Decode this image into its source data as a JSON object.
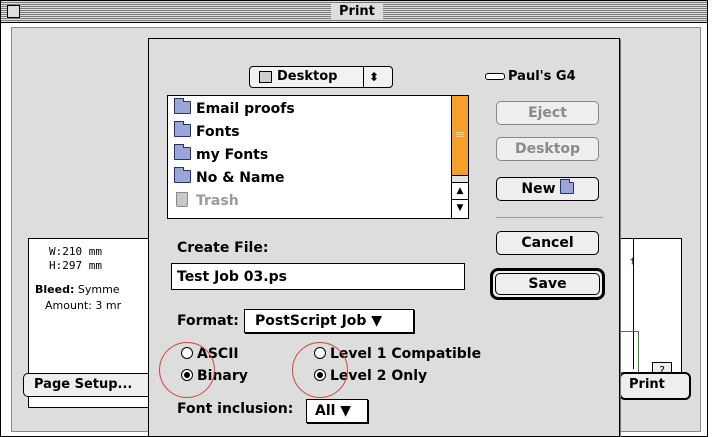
{
  "print_window": {
    "title": "Print",
    "page_info": {
      "width": "W:210  mm",
      "height": "H:297  mm",
      "bleed_label": "Bleed:",
      "bleed_value": "Symme",
      "amount": "Amount: 3  mr"
    },
    "help_label": "?",
    "page_setup_label": "Page Setup...",
    "print_label": "Print"
  },
  "save_dialog": {
    "folder_popup": {
      "label": "Desktop",
      "arrows": "⬍"
    },
    "disk_name": "Paul's G4",
    "files": [
      {
        "name": "Email proofs",
        "enabled": true
      },
      {
        "name": "Fonts",
        "enabled": true
      },
      {
        "name": "my Fonts",
        "enabled": true
      },
      {
        "name": "No & Name",
        "enabled": true
      },
      {
        "name": "Trash",
        "enabled": false
      }
    ],
    "buttons": {
      "eject": "Eject",
      "desktop": "Desktop",
      "new": "New",
      "cancel": "Cancel",
      "save": "Save"
    },
    "create_file_label": "Create File:",
    "filename_value": "Test Job 03.ps",
    "format_label": "Format:",
    "format_value": "PostScript Job ▼",
    "encoding": {
      "ascii": "ASCII",
      "binary": "Binary",
      "selected": "binary"
    },
    "level": {
      "level1": "Level 1 Compatible",
      "level2": "Level 2 Only",
      "selected": "level2"
    },
    "font_inclusion_label": "Font inclusion:",
    "font_inclusion_value": "All ▼"
  },
  "colors": {
    "scroll_thumb": "#f5a02a",
    "annotation_circle": "#d94040",
    "dialog_background": "#dddddd"
  }
}
